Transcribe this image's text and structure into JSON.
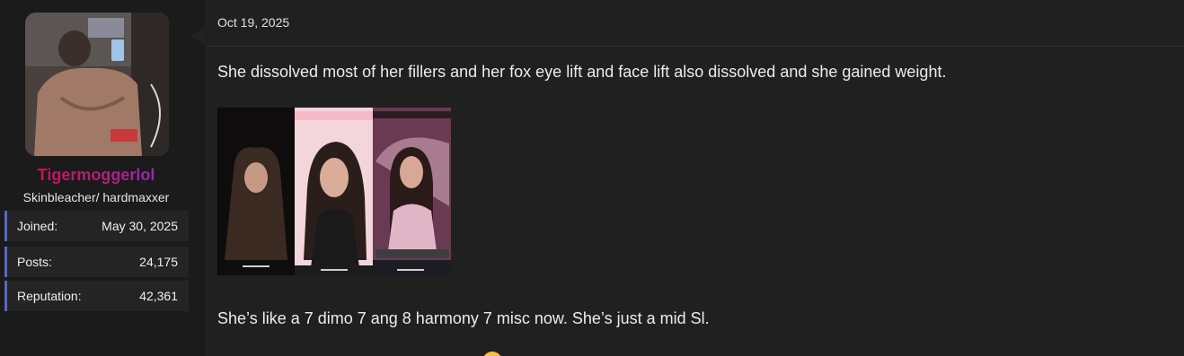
{
  "user": {
    "username": "Tigermoggerlol",
    "title": "Skinbleacher/ hardmaxxer",
    "avatar_icon": "avatar-photo",
    "stats": [
      {
        "label": "Joined:",
        "value": "May 30, 2025"
      },
      {
        "label": "Posts:",
        "value": "24,175"
      },
      {
        "label": "Reputation:",
        "value": "42,361"
      }
    ]
  },
  "post": {
    "date": "Oct 19, 2025",
    "paragraph_1": "She dissolved most of her fillers and her fox eye lift and face lift also dissolved and she gained weight.",
    "paragraph_2": "She’s like a 7 dimo 7 ang 8 harmony 7 misc now. She’s just a mid Sl.",
    "image_icon": "photo-collage-image",
    "emoji_icon": "smiley-emoji-icon"
  },
  "colors": {
    "page_bg": "#1b1b1b",
    "post_bg": "#202020",
    "stat_accent": "#5865c9",
    "username_start": "#d0103a",
    "username_end": "#8a2be2"
  }
}
